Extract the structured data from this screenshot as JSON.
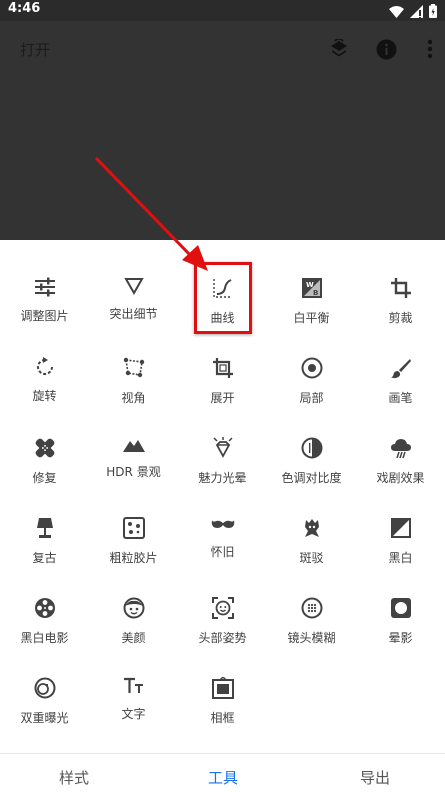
{
  "status_bar": {
    "time": "4:46"
  },
  "header": {
    "open_label": "打开"
  },
  "tools": [
    {
      "label": "调整图片",
      "icon": "sliders-icon"
    },
    {
      "label": "突出细节",
      "icon": "triangle-down-icon"
    },
    {
      "label": "曲线",
      "icon": "curves-icon"
    },
    {
      "label": "白平衡",
      "icon": "white-balance-icon"
    },
    {
      "label": "剪裁",
      "icon": "crop-icon"
    },
    {
      "label": "旋转",
      "icon": "rotate-icon"
    },
    {
      "label": "视角",
      "icon": "perspective-icon"
    },
    {
      "label": "展开",
      "icon": "expand-icon"
    },
    {
      "label": "局部",
      "icon": "selective-icon"
    },
    {
      "label": "画笔",
      "icon": "brush-icon"
    },
    {
      "label": "修复",
      "icon": "healing-icon"
    },
    {
      "label": "HDR 景观",
      "icon": "hdr-mountain-icon"
    },
    {
      "label": "魅力光晕",
      "icon": "glamour-glow-icon"
    },
    {
      "label": "色调对比度",
      "icon": "tonal-contrast-icon"
    },
    {
      "label": "戏剧效果",
      "icon": "drama-cloud-icon"
    },
    {
      "label": "复古",
      "icon": "vintage-lamp-icon"
    },
    {
      "label": "粗粒胶片",
      "icon": "grainy-film-icon"
    },
    {
      "label": "怀旧",
      "icon": "mustache-icon"
    },
    {
      "label": "斑驳",
      "icon": "grunge-icon"
    },
    {
      "label": "黑白",
      "icon": "black-white-icon"
    },
    {
      "label": "黑白电影",
      "icon": "film-reel-icon"
    },
    {
      "label": "美颜",
      "icon": "face-icon"
    },
    {
      "label": "头部姿势",
      "icon": "head-pose-icon"
    },
    {
      "label": "镜头模糊",
      "icon": "lens-blur-icon"
    },
    {
      "label": "晕影",
      "icon": "vignette-icon"
    },
    {
      "label": "双重曝光",
      "icon": "double-exposure-icon"
    },
    {
      "label": "文字",
      "icon": "text-icon"
    },
    {
      "label": "相框",
      "icon": "frame-icon"
    }
  ],
  "bottom_nav": {
    "styles": "样式",
    "tools": "工具",
    "export": "导出"
  },
  "colors": {
    "accent": "#1a73e8",
    "highlight": "#e01010",
    "top_background": "#333333",
    "icon": "#424242"
  }
}
